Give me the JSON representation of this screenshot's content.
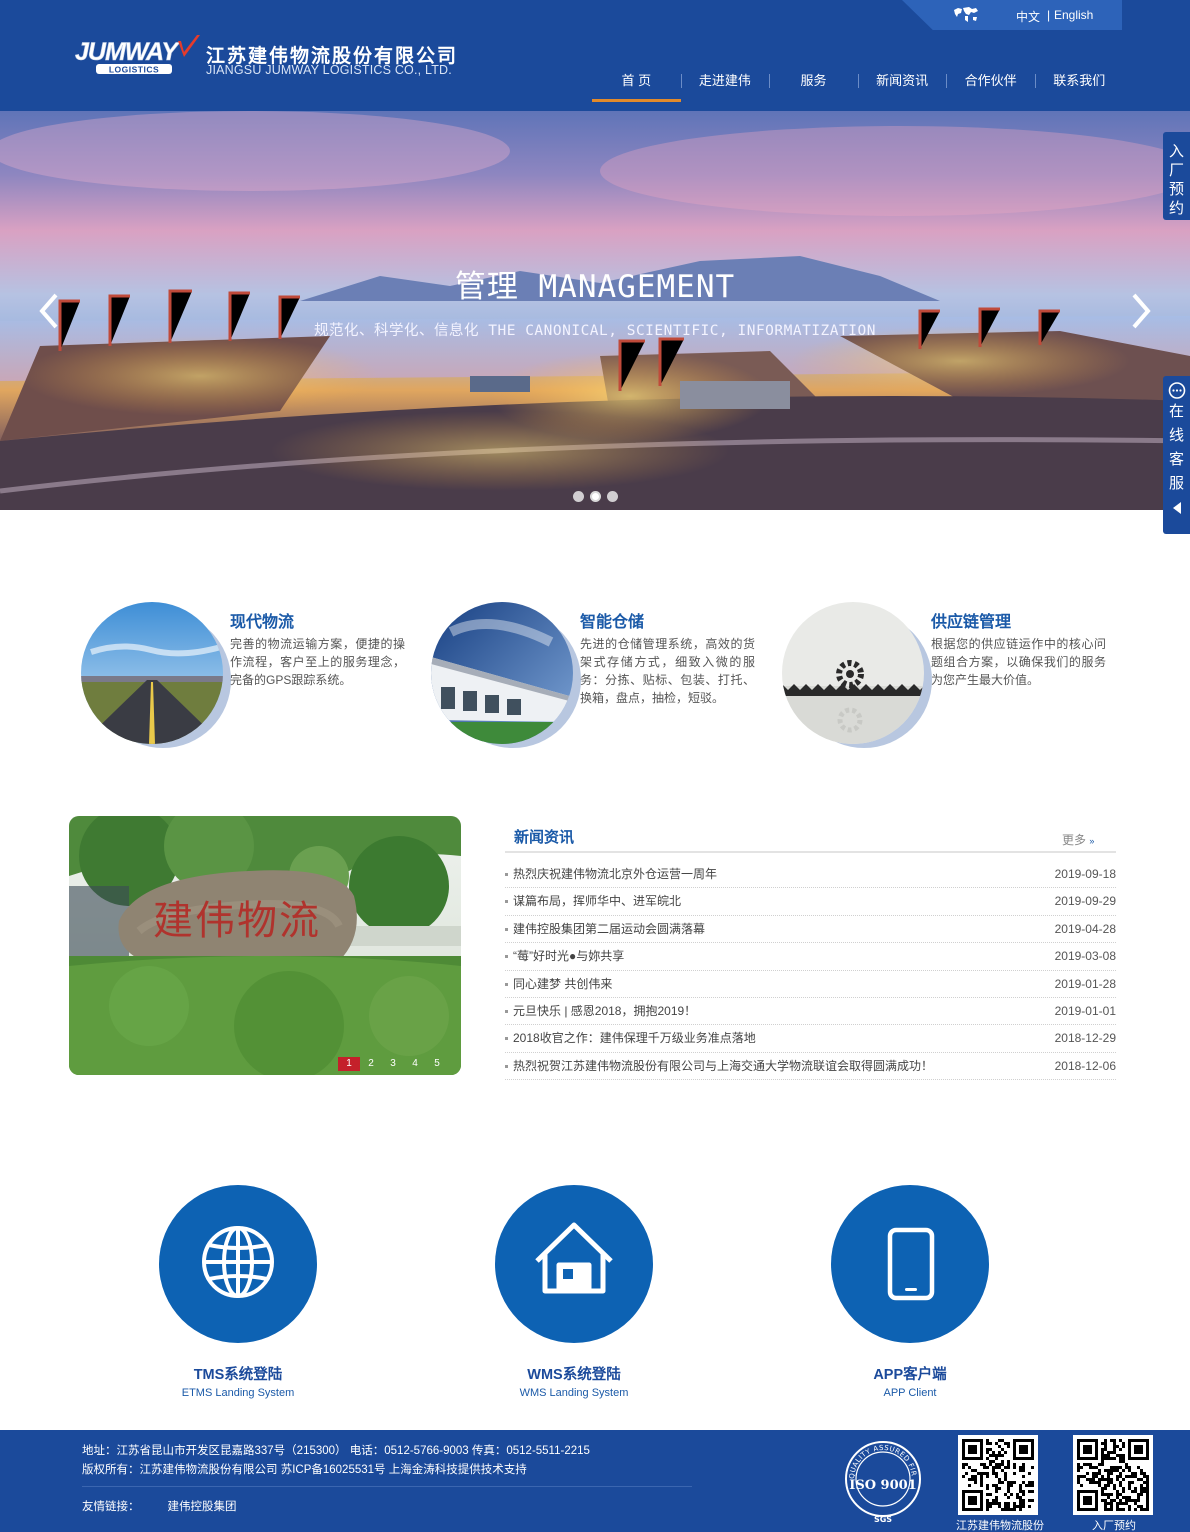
{
  "header": {
    "lang_zh": "中文",
    "lang_sep": "|",
    "lang_en": "English",
    "logo_text": "JUMWAY",
    "logo_sub": "LOGISTICS",
    "company_cn": "江苏建伟物流股份有限公司",
    "company_en": "JIANGSU JUMWAY LOGISTICS CO., LTD."
  },
  "nav": [
    {
      "label": "首 页",
      "active": true
    },
    {
      "label": "走进建伟"
    },
    {
      "label": "服务"
    },
    {
      "label": "新闻资讯"
    },
    {
      "label": "合作伙伴"
    },
    {
      "label": "联系我们"
    }
  ],
  "banner": {
    "title": "管理 MANAGEMENT",
    "subtitle": "规范化、科学化、信息化  THE CANONICAL, SCIENTIFIC, INFORMATIZATION",
    "slides": 3,
    "active_slide": 1
  },
  "side": {
    "reserve": [
      "入",
      "厂",
      "预",
      "约"
    ],
    "service": [
      "在",
      "线",
      "客",
      "服"
    ]
  },
  "features": [
    {
      "title": "现代物流",
      "text": "完善的物流运输方案，便捷的操作流程，客户至上的服务理念，完备的GPS跟踪系统。"
    },
    {
      "title": "智能仓储",
      "text": "先进的仓储管理系统，高效的货架式存储方式，细致入微的服务：分拣、贴标、包装、打托、换箱，盘点，抽检，短驳。"
    },
    {
      "title": "供应链管理",
      "text": "根据您的供应链运作中的核心问题组合方案，以确保我们的服务为您产生最大价值。"
    }
  ],
  "news": {
    "title": "新闻资讯",
    "more": "更多",
    "photo_text": "建伟物流",
    "photo_pages": [
      "1",
      "2",
      "3",
      "4",
      "5"
    ],
    "items": [
      {
        "title": "热烈庆祝建伟物流北京外仓运营一周年",
        "date": "2019-09-18"
      },
      {
        "title": "谋篇布局，挥师华中、进军皖北",
        "date": "2019-09-29"
      },
      {
        "title": "建伟控股集团第二届运动会圆满落幕",
        "date": "2019-04-28"
      },
      {
        "title": "“莓”好时光●与妳共享",
        "date": "2019-03-08"
      },
      {
        "title": "同心建梦 共创伟来",
        "date": "2019-01-28"
      },
      {
        "title": "元旦快乐 | 感恩2018，拥抱2019！",
        "date": "2019-01-01"
      },
      {
        "title": "2018收官之作：建伟保理千万级业务准点落地",
        "date": "2018-12-29"
      },
      {
        "title": "热烈祝贺江苏建伟物流股份有限公司与上海交通大学物流联谊会取得圆满成功！",
        "date": "2018-12-06"
      }
    ]
  },
  "systems": [
    {
      "title": "TMS系统登陆",
      "en": "ETMS Landing System",
      "icon": "globe-icon"
    },
    {
      "title": "WMS系统登陆",
      "en": "WMS Landing System",
      "icon": "warehouse-icon"
    },
    {
      "title": "APP客户端",
      "en": "APP Client",
      "icon": "phone-icon"
    }
  ],
  "footer": {
    "address_line": "地址：江苏省昆山市开发区昆嘉路337号（215300）  电话：0512-5766-9003  传真：0512-5511-2215",
    "copyright_line": "版权所有：江苏建伟物流股份有限公司    苏ICP备16025531号    上海金涛科技提供技术支持",
    "links_label": "友情链接：",
    "links": [
      "建伟控股集团"
    ],
    "iso_text": "ISO 9001",
    "iso_ring": "QUALITY ASSURED FIRM",
    "iso_sgs": "SGS",
    "qr_captions": [
      "江苏建伟物流股份",
      "入厂预约"
    ]
  },
  "colors": {
    "primary": "#1b4a9b",
    "accent": "#e28a2b",
    "title_blue": "#1b5aa8",
    "system_blue": "#0d62b3"
  }
}
